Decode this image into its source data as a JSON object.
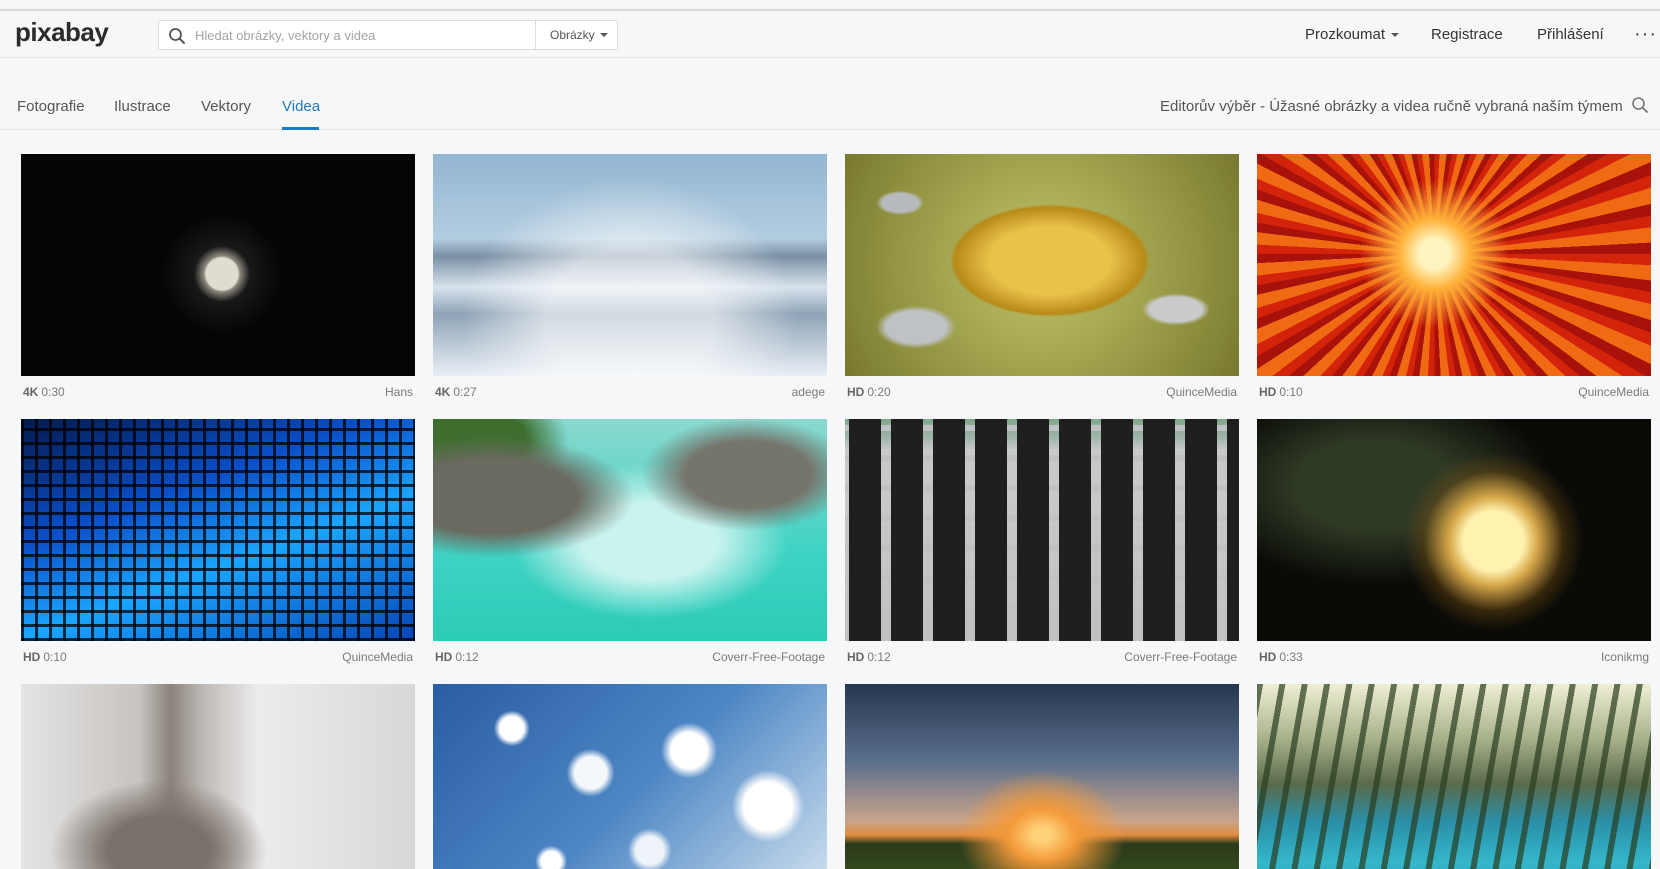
{
  "header": {
    "logo_text": "pixabay",
    "search_placeholder": "Hledat obrázky, vektory a videa",
    "search_type": "Obrázky",
    "nav": {
      "explore": "Prozkoumat",
      "register": "Registrace",
      "login": "Přihlášení",
      "more": "···"
    }
  },
  "tabs": {
    "items": [
      "Fotografie",
      "Ilustrace",
      "Vektory",
      "Videa"
    ],
    "active": "Videa",
    "editors_choice": "Editorův výběr - Úžasné obrázky a videa ručně vybraná naším týmem"
  },
  "videos": [
    {
      "quality": "4K",
      "duration": "0:30",
      "author": "Hans"
    },
    {
      "quality": "4K",
      "duration": "0:27",
      "author": "adege"
    },
    {
      "quality": "HD",
      "duration": "0:20",
      "author": "QuinceMedia"
    },
    {
      "quality": "HD",
      "duration": "0:10",
      "author": "QuinceMedia"
    },
    {
      "quality": "HD",
      "duration": "0:10",
      "author": "QuinceMedia"
    },
    {
      "quality": "HD",
      "duration": "0:12",
      "author": "Coverr-Free-Footage"
    },
    {
      "quality": "HD",
      "duration": "0:12",
      "author": "Coverr-Free-Footage"
    },
    {
      "quality": "HD",
      "duration": "0:33",
      "author": "Iconikmg"
    }
  ],
  "colors": {
    "accent": "#1f7bc1",
    "text": "#333333",
    "muted": "#7a7a7a"
  }
}
